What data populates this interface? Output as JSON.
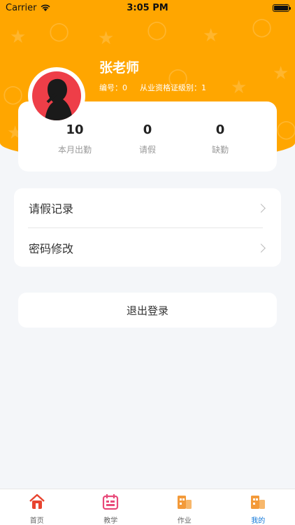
{
  "status_bar": {
    "carrier": "Carrier",
    "time": "3:05 PM"
  },
  "profile": {
    "name": "张老师",
    "id_label": "编号：0",
    "level_label": "从业资格证级别：1"
  },
  "stats": [
    {
      "value": "10",
      "label": "本月出勤"
    },
    {
      "value": "0",
      "label": "请假"
    },
    {
      "value": "0",
      "label": "缺勤"
    }
  ],
  "menu": {
    "leave_records": "请假记录",
    "change_password": "密码修改"
  },
  "logout_label": "退出登录",
  "tabs": [
    {
      "label": "首页",
      "icon": "home-icon"
    },
    {
      "label": "教学",
      "icon": "calendar-icon"
    },
    {
      "label": "作业",
      "icon": "building-icon"
    },
    {
      "label": "我的",
      "icon": "building-icon",
      "active": true
    }
  ],
  "colors": {
    "header": "#ffa600",
    "tab_active": "#1177d8",
    "avatar_bg": "#ee3e48"
  }
}
